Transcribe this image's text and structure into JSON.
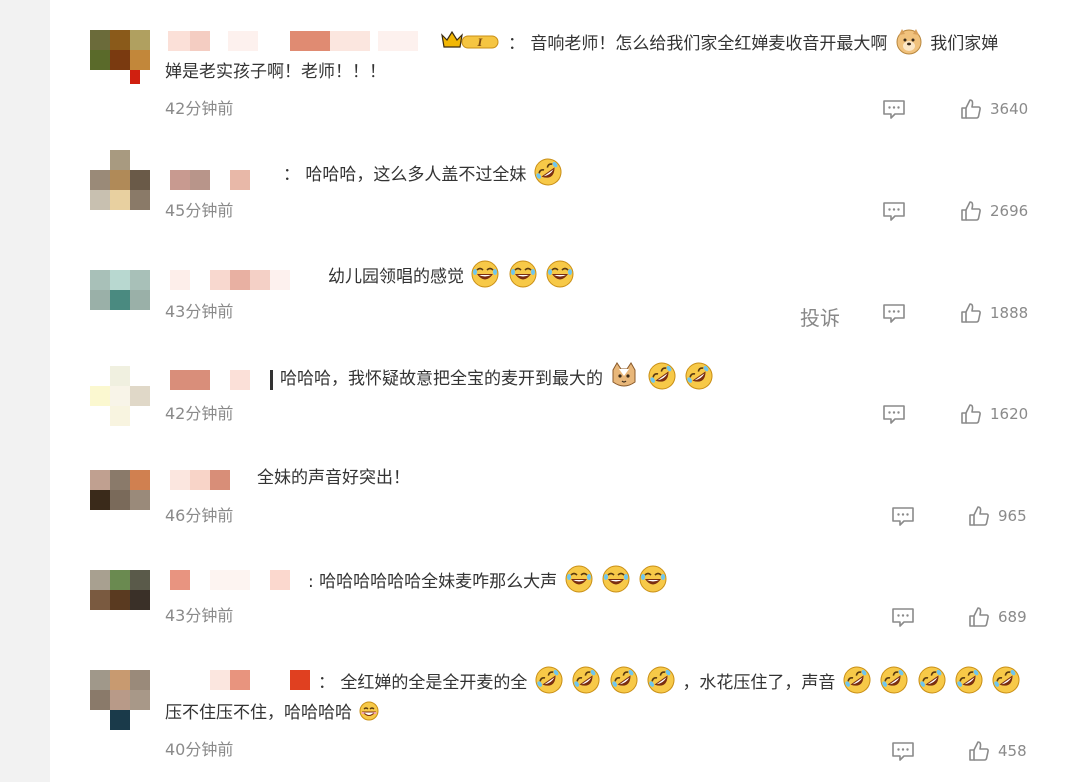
{
  "comments": [
    {
      "separator": "：",
      "segments": [
        "音响老师！怎么给我们家全红婵麦收音开最大啊",
        "我们家婵"
      ],
      "line2": "婵是老实孩子啊！老师！！！",
      "time": "42分钟前",
      "likes": "3640"
    },
    {
      "separator": "：",
      "text": "哈哈哈，这么多人盖不过全妹",
      "time": "45分钟前",
      "likes": "2696"
    },
    {
      "text": "幼儿园领唱的感觉",
      "time": "43分钟前",
      "report": "投诉",
      "likes": "1888"
    },
    {
      "text": "哈哈哈，我怀疑故意把全宝的麦开到最大的",
      "time": "42分钟前",
      "likes": "1620"
    },
    {
      "text": "全妹的声音好突出！",
      "time": "46分钟前",
      "likes": "965"
    },
    {
      "separator": ":",
      "text": "哈哈哈哈哈哈全妹麦咋那么大声",
      "time": "43分钟前",
      "likes": "689"
    },
    {
      "separator": "：",
      "segments": [
        "全红婵的全是全开麦的全",
        "，水花压住了，声音"
      ],
      "line2": "压不住压不住，哈哈哈哈",
      "time": "40分钟前",
      "likes": "458"
    }
  ],
  "icons": {
    "reply": "comment-icon",
    "like": "thumbs-up-icon",
    "badge": "crown-vip-badge",
    "laugh": "laughing-tears-emoji",
    "rofl": "rolling-laughing-emoji",
    "doge": "doge-emoji",
    "cat": "cat-emoji",
    "grin": "grinning-emoji"
  },
  "colors": {
    "text": "#333333",
    "muted": "#8a8a8a",
    "emoji_yellow": "#f7c948",
    "badge_gold": "#f2b705"
  }
}
